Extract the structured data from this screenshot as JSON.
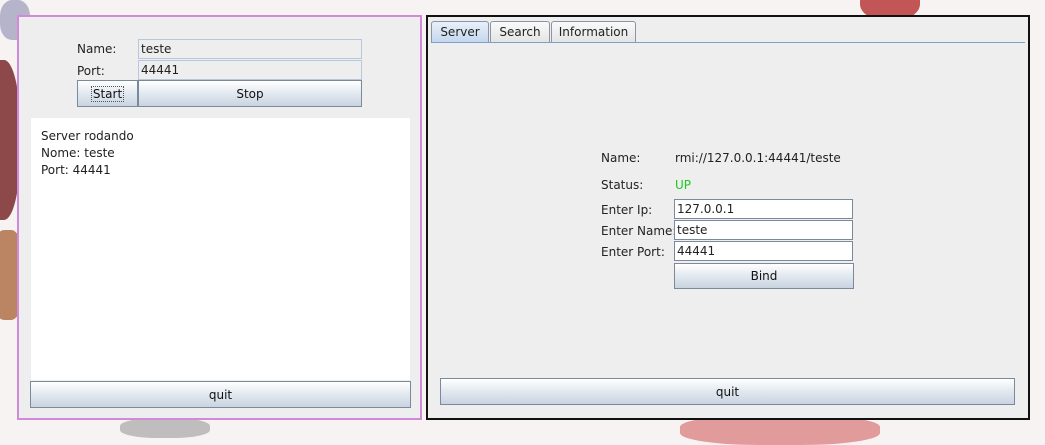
{
  "left_window": {
    "name_label": "Name:",
    "name_value": "teste",
    "port_label": "Port:",
    "port_value": "44441",
    "start_label": "Start",
    "stop_label": "Stop",
    "log_lines": [
      "Server rodando",
      "Nome: teste",
      "Port: 44441"
    ],
    "quit_label": "quit"
  },
  "right_window": {
    "tabs": [
      {
        "label": "Server",
        "active": true
      },
      {
        "label": "Search",
        "active": false
      },
      {
        "label": "Information",
        "active": false
      }
    ],
    "name_label": "Name:",
    "name_value": "rmi://127.0.0.1:44441/teste",
    "status_label": "Status:",
    "status_value": "UP",
    "status_color": "#1ec81e",
    "ip_label": "Enter Ip:",
    "ip_value": "127.0.0.1",
    "enter_name_label": "Enter Name:",
    "enter_name_value": "teste",
    "enter_port_label": "Enter Port:",
    "enter_port_value": "44441",
    "bind_label": "Bind",
    "quit_label": "quit"
  }
}
